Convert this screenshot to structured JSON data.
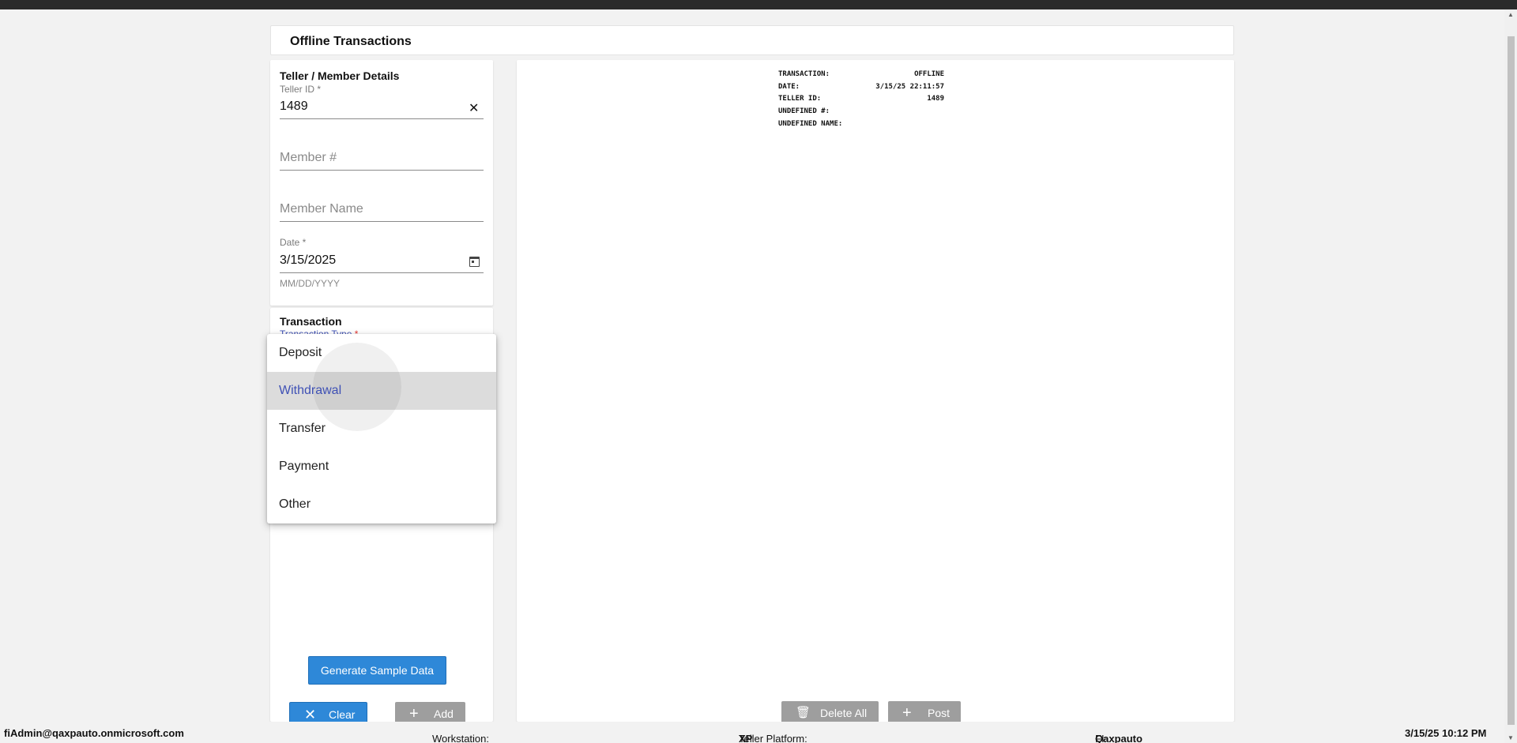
{
  "page_title": "Offline Transactions",
  "teller_member": {
    "section_title": "Teller / Member Details",
    "teller_id_label": "Teller ID *",
    "teller_id_value": "1489",
    "member_number_placeholder": "Member #",
    "member_name_placeholder": "Member Name",
    "date_label": "Date *",
    "date_value": "3/15/2025",
    "date_helper": "MM/DD/YYYY"
  },
  "transaction": {
    "section_title": "Transaction",
    "type_label": "Transaction Type",
    "type_required": "*",
    "options": [
      "Deposit",
      "Withdrawal",
      "Transfer",
      "Payment",
      "Other"
    ],
    "selected_option": "Withdrawal"
  },
  "buttons": {
    "generate": "Generate Sample Data",
    "clear": "Clear",
    "add": "Add",
    "delete_all": "Delete All",
    "post": "Post"
  },
  "receipt": {
    "rows": [
      {
        "key": "TRANSACTION:",
        "value": "OFFLINE"
      },
      {
        "key": "DATE:",
        "value": "3/15/25 22:11:57"
      },
      {
        "key": "TELLER ID:",
        "value": "1489"
      },
      {
        "key": "UNDEFINED #:",
        "value": ""
      },
      {
        "key": "UNDEFINED NAME:",
        "value": ""
      }
    ]
  },
  "status_bar": {
    "user": "fiAdmin@qaxpauto.onmicrosoft.com",
    "workstation_label": "Workstation:",
    "workstation_value": "",
    "platform_label": "Teller Platform:",
    "platform_value": "XP",
    "fi_label": "FI:",
    "fi_value": "Qaxpauto",
    "datetime": "3/15/25 10:12 PM"
  },
  "colors": {
    "accent": "#3f51b5",
    "primary_button": "#2e88d8",
    "disabled_button": "#9e9e9e",
    "required": "#e53935"
  },
  "icons": {
    "clear_field": "close-icon",
    "date_picker": "calendar-icon",
    "clear_button": "close-icon",
    "add_button": "plus-icon",
    "delete_button": "trash-icon",
    "post_button": "plus-icon"
  }
}
